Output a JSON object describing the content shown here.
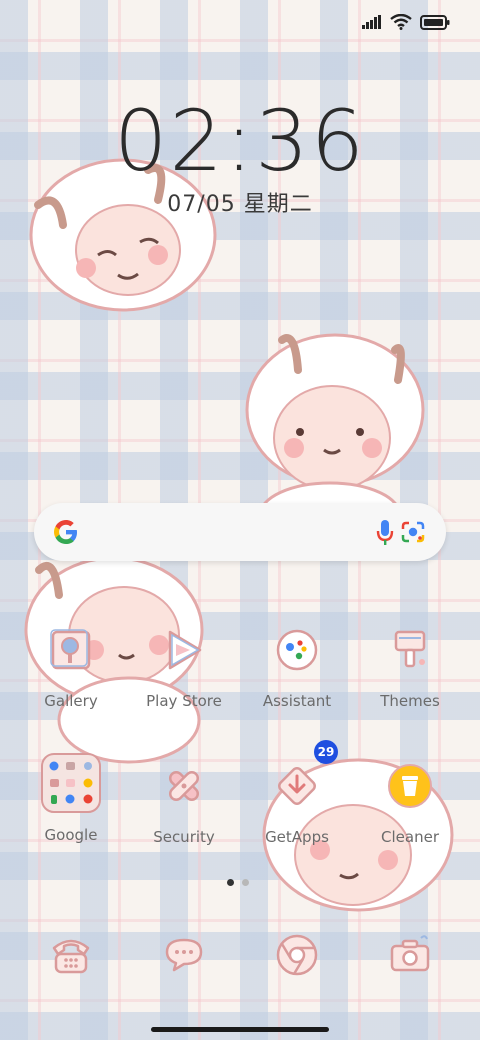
{
  "status_bar": {
    "icons": [
      "signal-icon",
      "wifi-icon",
      "battery-icon"
    ]
  },
  "lockclock": {
    "time": "02:36",
    "date": "07/05 星期二"
  },
  "search_bar": {
    "icons": [
      "google-logo",
      "mic-icon",
      "lens-icon"
    ]
  },
  "apps_row1": [
    {
      "label": "Gallery",
      "icon": "gallery-icon"
    },
    {
      "label": "Play Store",
      "icon": "play-store-icon"
    },
    {
      "label": "Assistant",
      "icon": "assistant-icon"
    },
    {
      "label": "Themes",
      "icon": "themes-icon"
    }
  ],
  "apps_row2": [
    {
      "label": "Google",
      "icon": "google-folder"
    },
    {
      "label": "Security",
      "icon": "security-icon"
    },
    {
      "label": "GetApps",
      "icon": "getapps-icon",
      "badge": "29"
    },
    {
      "label": "Cleaner",
      "icon": "cleaner-icon"
    }
  ],
  "dock": [
    {
      "icon": "phone-icon"
    },
    {
      "icon": "messages-icon"
    },
    {
      "icon": "chrome-icon"
    },
    {
      "icon": "camera-icon"
    }
  ],
  "page_indicator": {
    "pages": 2,
    "current": 1
  },
  "colors": {
    "accent": "#e8a0a8",
    "badge": "#1f4fe0",
    "outline": "#d99a9a"
  }
}
